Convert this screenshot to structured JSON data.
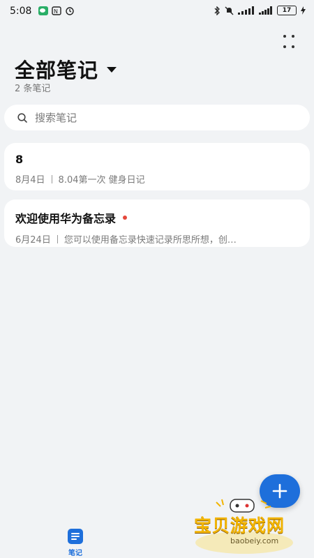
{
  "status_bar": {
    "time": "5:08",
    "battery": "17"
  },
  "header": {
    "title": "全部笔记",
    "count": "2 条笔记"
  },
  "search": {
    "placeholder": "搜索笔记"
  },
  "notes": [
    {
      "title": "8",
      "date": "8月4日",
      "preview": "8.04第一次 健身日记",
      "unread": false
    },
    {
      "title": "欢迎使用华为备忘录",
      "date": "6月24日",
      "preview": "您可以使用备忘录快速记录所思所想，创…",
      "unread": true
    }
  ],
  "bottom_nav": {
    "notes_label": "笔记"
  },
  "watermark": {
    "name": "宝贝游戏网",
    "url": "baobeiy.com"
  },
  "colors": {
    "accent": "#1e6fdb",
    "background": "#f1f3f5",
    "unread_dot": "#e5483c"
  }
}
